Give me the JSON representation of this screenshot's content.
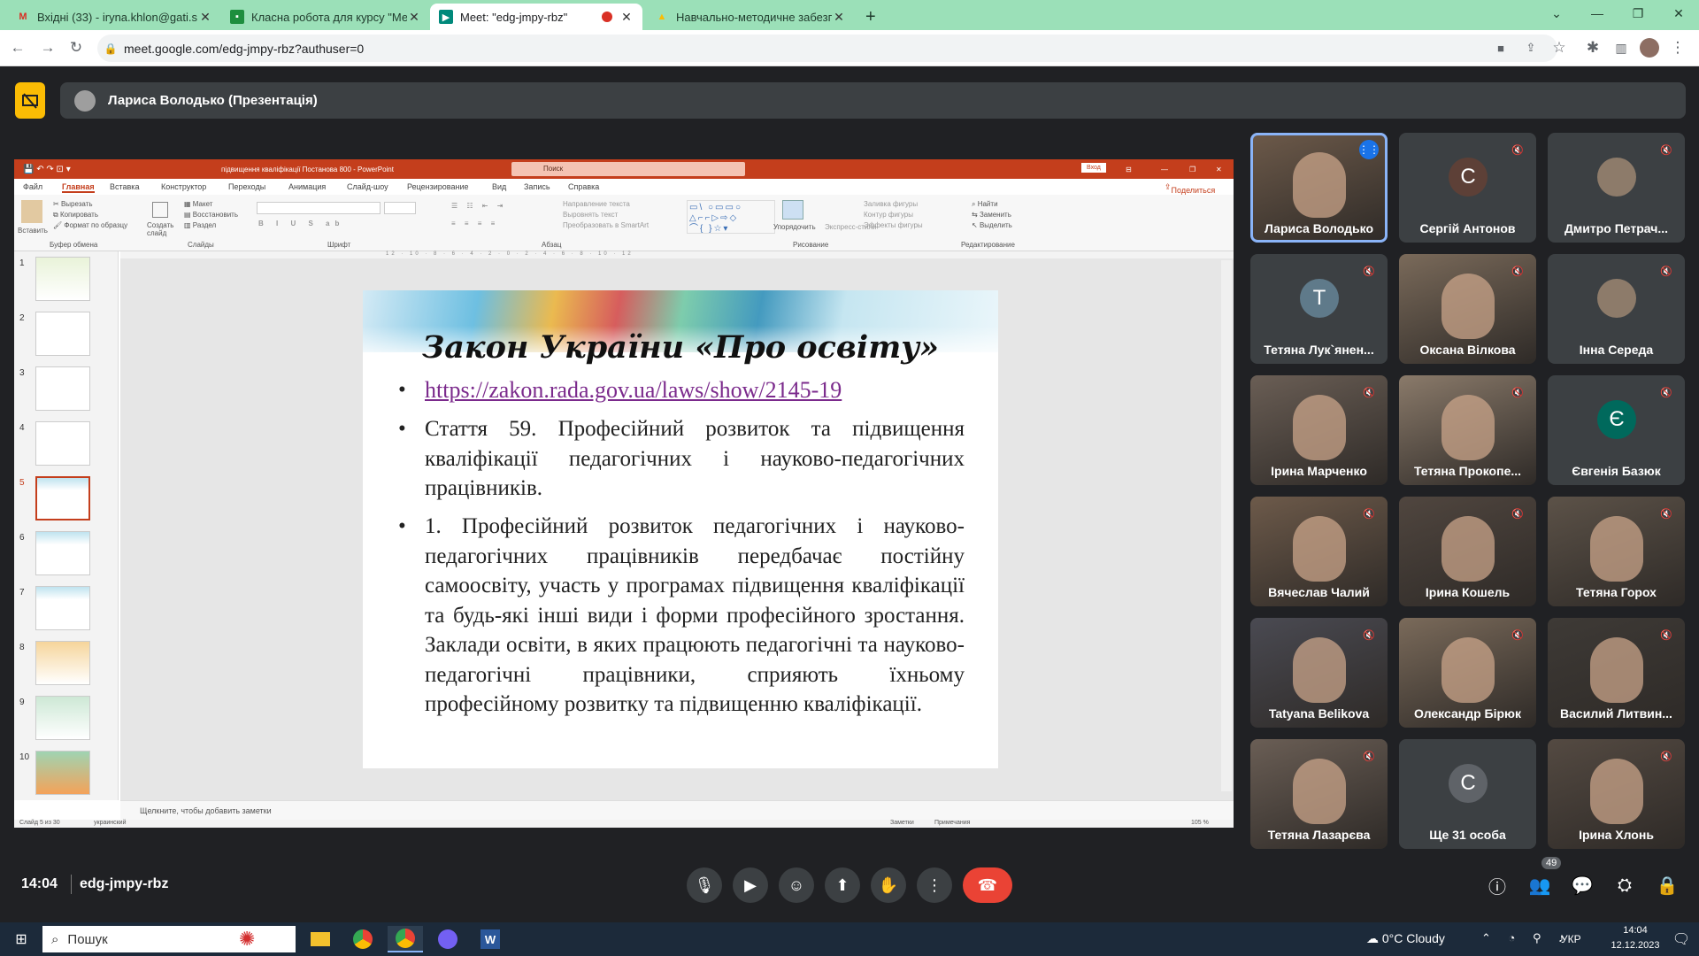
{
  "browser": {
    "tabs": [
      {
        "label": "Вхідні (33) - iryna.khlon@gati.s",
        "icon": "gmail-icon",
        "active": false
      },
      {
        "label": "Класна робота для курсу \"Мет",
        "icon": "classroom-icon",
        "active": false
      },
      {
        "label": "Meet: \"edg-jmpy-rbz\"",
        "icon": "meet-icon",
        "active": true
      },
      {
        "label": "Навчально-методичне забезп",
        "icon": "drive-icon",
        "active": false
      }
    ],
    "new_tab": "+",
    "url": "meet.google.com/edg-jmpy-rbz?authuser=0"
  },
  "meet": {
    "presenter_label": "Лариса Володько (Презентація)",
    "time": "14:04",
    "meeting_code": "edg-jmpy-rbz",
    "participant_count": "49",
    "participants": [
      {
        "name": "Лариса Володько",
        "avatar": "",
        "video": true,
        "speaking": true
      },
      {
        "name": "Сергій Антонов",
        "avatar": "С",
        "color": "#5d4037",
        "video": false
      },
      {
        "name": "Дмитро Петрач...",
        "avatar": "",
        "video": false
      },
      {
        "name": "Тетяна Лук`янен...",
        "avatar": "Т",
        "color": "#5f7a8a",
        "video": false
      },
      {
        "name": "Оксана Вілкова",
        "avatar": "",
        "video": true
      },
      {
        "name": "Інна Середа",
        "avatar": "",
        "video": false
      },
      {
        "name": "Ірина Марченко",
        "avatar": "",
        "video": true
      },
      {
        "name": "Тетяна Прокопе...",
        "avatar": "",
        "video": true
      },
      {
        "name": "Євгенія Базюк",
        "avatar": "Є",
        "color": "#00695c",
        "video": false
      },
      {
        "name": "Вячеслав Чалий",
        "avatar": "",
        "video": true
      },
      {
        "name": "Ірина Кошель",
        "avatar": "",
        "video": true
      },
      {
        "name": "Тетяна Горох",
        "avatar": "",
        "video": true
      },
      {
        "name": "Tatyana Belikova",
        "avatar": "",
        "video": true
      },
      {
        "name": "Олександр Бірюк",
        "avatar": "",
        "video": true
      },
      {
        "name": "Василий Литвин...",
        "avatar": "",
        "video": true
      },
      {
        "name": "Тетяна Лазарєва",
        "avatar": "",
        "video": true
      },
      {
        "name": "Ще 31 особа",
        "avatar": "С",
        "video": false
      },
      {
        "name": "Ірина Хлонь",
        "avatar": "",
        "video": true
      }
    ]
  },
  "ppt": {
    "title": "підвищення кваліфікації Постанова 800  -  PowerPoint",
    "search": "Поиск",
    "signin": "Вход",
    "share": "Поделиться",
    "menu": [
      "Файл",
      "Главная",
      "Вставка",
      "Конструктор",
      "Переходы",
      "Анимация",
      "Слайд-шоу",
      "Рецензирование",
      "Вид",
      "Запись",
      "Справка"
    ],
    "ribbon_groups": [
      "Буфер обмена",
      "Слайды",
      "Шрифт",
      "Абзац",
      "Рисование",
      "Редактирование"
    ],
    "ribbon_buttons": {
      "paste": "Вставить",
      "cut": "Вырезать",
      "copy": "Копировать",
      "format": "Формат по образцу",
      "new_slide": "Создать слайд",
      "layout": "Макет",
      "reset": "Восстановить",
      "section": "Раздел",
      "arrange": "Упорядочить",
      "quick_styles": "Экспресс-стили",
      "find": "Найти",
      "replace": "Заменить",
      "select": "Выделить",
      "fill": "Заливка фигуры",
      "outline": "Контур фигуры",
      "effects": "Эффекты фигуры",
      "text_dir": "Направление текста",
      "align_text": "Выровнять текст",
      "smartart": "Преобразовать в SmartArt"
    },
    "slide_numbers": [
      "1",
      "2",
      "3",
      "4",
      "5",
      "6",
      "7",
      "8",
      "9",
      "10"
    ],
    "selected_slide": "5",
    "notes_placeholder": "Щелкните, чтобы добавить заметки",
    "status_slide": "Слайд 5 из 30",
    "status_lang": "украинский",
    "status_notes": "Заметки",
    "status_comments": "Примечания",
    "zoom": "105 %"
  },
  "slide": {
    "title": "Закон України «Про освіту»",
    "link": "https://zakon.rada.gov.ua/laws/show/2145-19",
    "bullet2": "Стаття 59. Професійний розвиток та підвищення кваліфікації педагогічних і науково-педагогічних працівників.",
    "bullet3": "1. Професійний розвиток педагогічних і науково-педагогічних працівників передбачає постійну самоосвіту, участь у програмах підвищення кваліфікації та будь-які інші види і форми професійного зростання. Заклади освіти, в яких працюють педагогічні та науково-педагогічні працівники, сприяють їхньому професійному розвитку та підвищенню кваліфікації.",
    "bullet_char": "•"
  },
  "taskbar": {
    "search": "Пошук",
    "weather": "0°C  Cloudy",
    "lang": "УКР",
    "time": "14:04",
    "date": "12.12.2023"
  },
  "colors": {
    "meet_bg": "#202124",
    "tile_bg": "#3c4043",
    "end_call": "#ea4335",
    "ppt_red": "#c43e1c",
    "chrome_tabbar": "#9be0b8"
  }
}
